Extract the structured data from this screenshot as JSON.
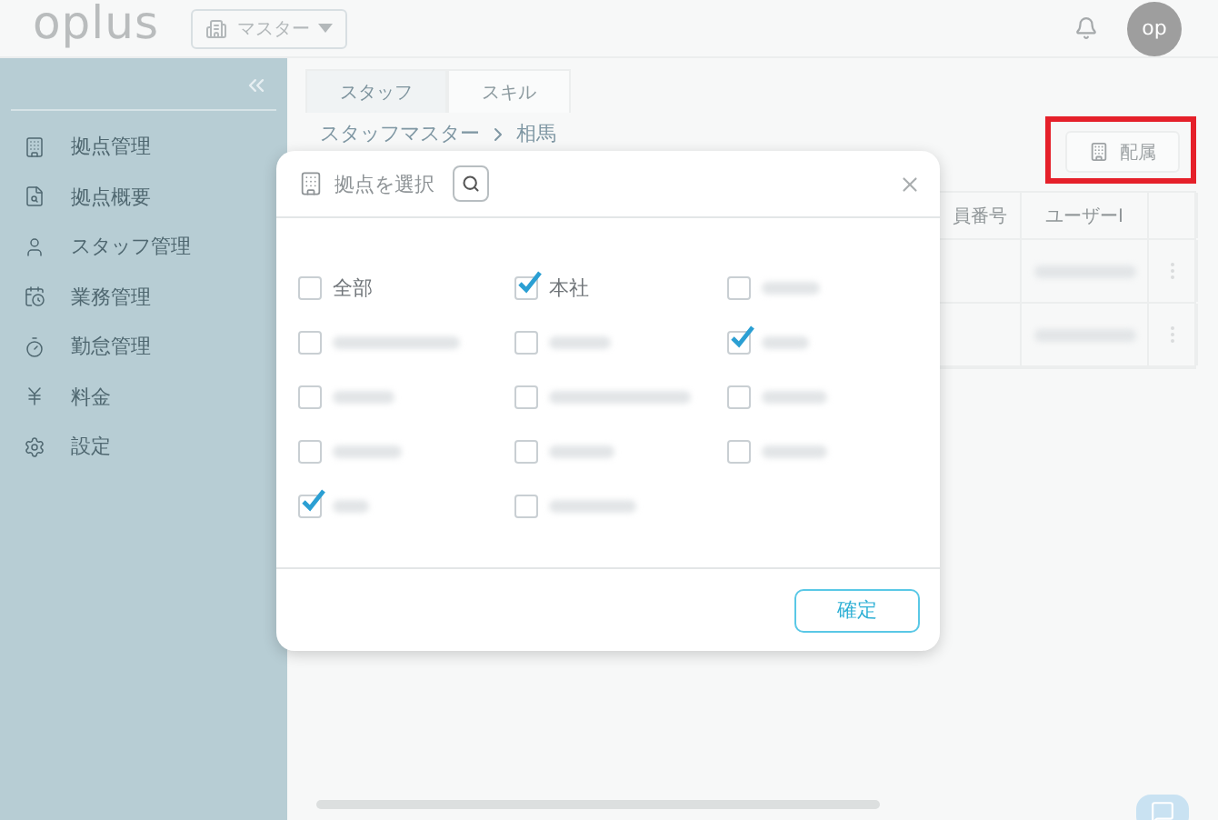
{
  "header": {
    "logo": "oplus",
    "menu": "マスター",
    "avatar": "op"
  },
  "sidebar": {
    "items": [
      {
        "label": "拠点管理"
      },
      {
        "label": "拠点概要"
      },
      {
        "label": "スタッフ管理"
      },
      {
        "label": "業務管理"
      },
      {
        "label": "勤怠管理"
      },
      {
        "label": "料金"
      },
      {
        "label": "設定"
      }
    ]
  },
  "tabs": [
    {
      "label": "スタッフ",
      "selected": true
    },
    {
      "label": "スキル",
      "selected": false
    }
  ],
  "breadcrumb": [
    "スタッフマスター",
    "相馬"
  ],
  "assign_button": {
    "label": "配属",
    "highlighted": true
  },
  "table": {
    "columns": [
      "員番号",
      "ユーザーI"
    ],
    "rows": [
      {
        "kind": "blurred"
      },
      {
        "kind": "blurred"
      }
    ]
  },
  "dialog": {
    "title": "拠点を選択",
    "options": [
      {
        "kind": "text",
        "label": "全部",
        "checked": false
      },
      {
        "kind": "text",
        "label": "本社",
        "checked": true
      },
      {
        "kind": "blurred",
        "checked": false
      },
      {
        "kind": "blurred",
        "checked": false
      },
      {
        "kind": "blurred",
        "checked": false
      },
      {
        "kind": "blurred",
        "checked": true
      },
      {
        "kind": "blurred",
        "checked": false
      },
      {
        "kind": "blurred",
        "checked": false
      },
      {
        "kind": "blurred",
        "checked": false
      },
      {
        "kind": "blurred",
        "checked": false
      },
      {
        "kind": "blurred",
        "checked": false
      },
      {
        "kind": "blurred",
        "checked": false
      },
      {
        "kind": "blurred",
        "checked": true
      },
      {
        "kind": "blurred",
        "checked": false
      }
    ],
    "confirm": "確定"
  }
}
